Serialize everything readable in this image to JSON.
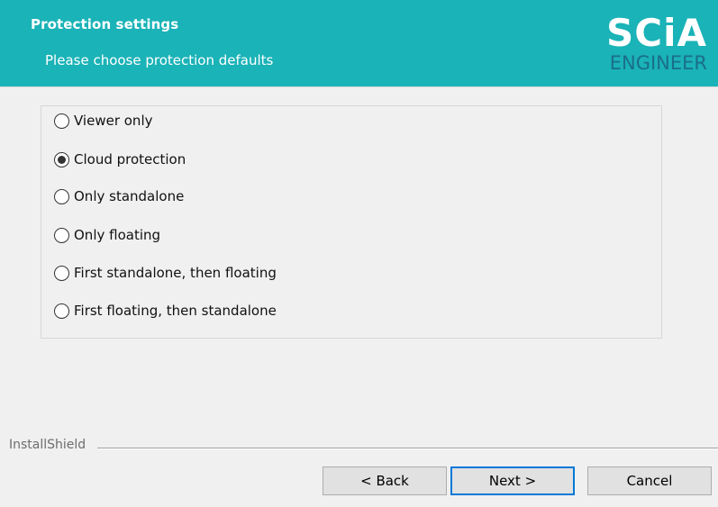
{
  "header": {
    "title": "Protection settings",
    "subtitle": "Please choose protection defaults",
    "background_color": "#1ab3b7",
    "logo": {
      "line1": "SCiA",
      "line2": "ENGINEER",
      "line1_color": "#ffffff",
      "line2_color": "#1a6e8a"
    }
  },
  "protection_options": {
    "selected": "Cloud protection",
    "items": [
      {
        "label": "Viewer only",
        "checked": false
      },
      {
        "label": "Cloud protection",
        "checked": true
      },
      {
        "label": "Only standalone",
        "checked": false
      },
      {
        "label": "Only floating",
        "checked": false
      },
      {
        "label": "First standalone, then floating",
        "checked": false
      },
      {
        "label": "First floating, then standalone",
        "checked": false
      }
    ]
  },
  "footer": {
    "brand_label": "InstallShield",
    "back_label": "< Back",
    "next_label": "Next >",
    "cancel_label": "Cancel",
    "default_button_border_color": "#0078d7"
  }
}
